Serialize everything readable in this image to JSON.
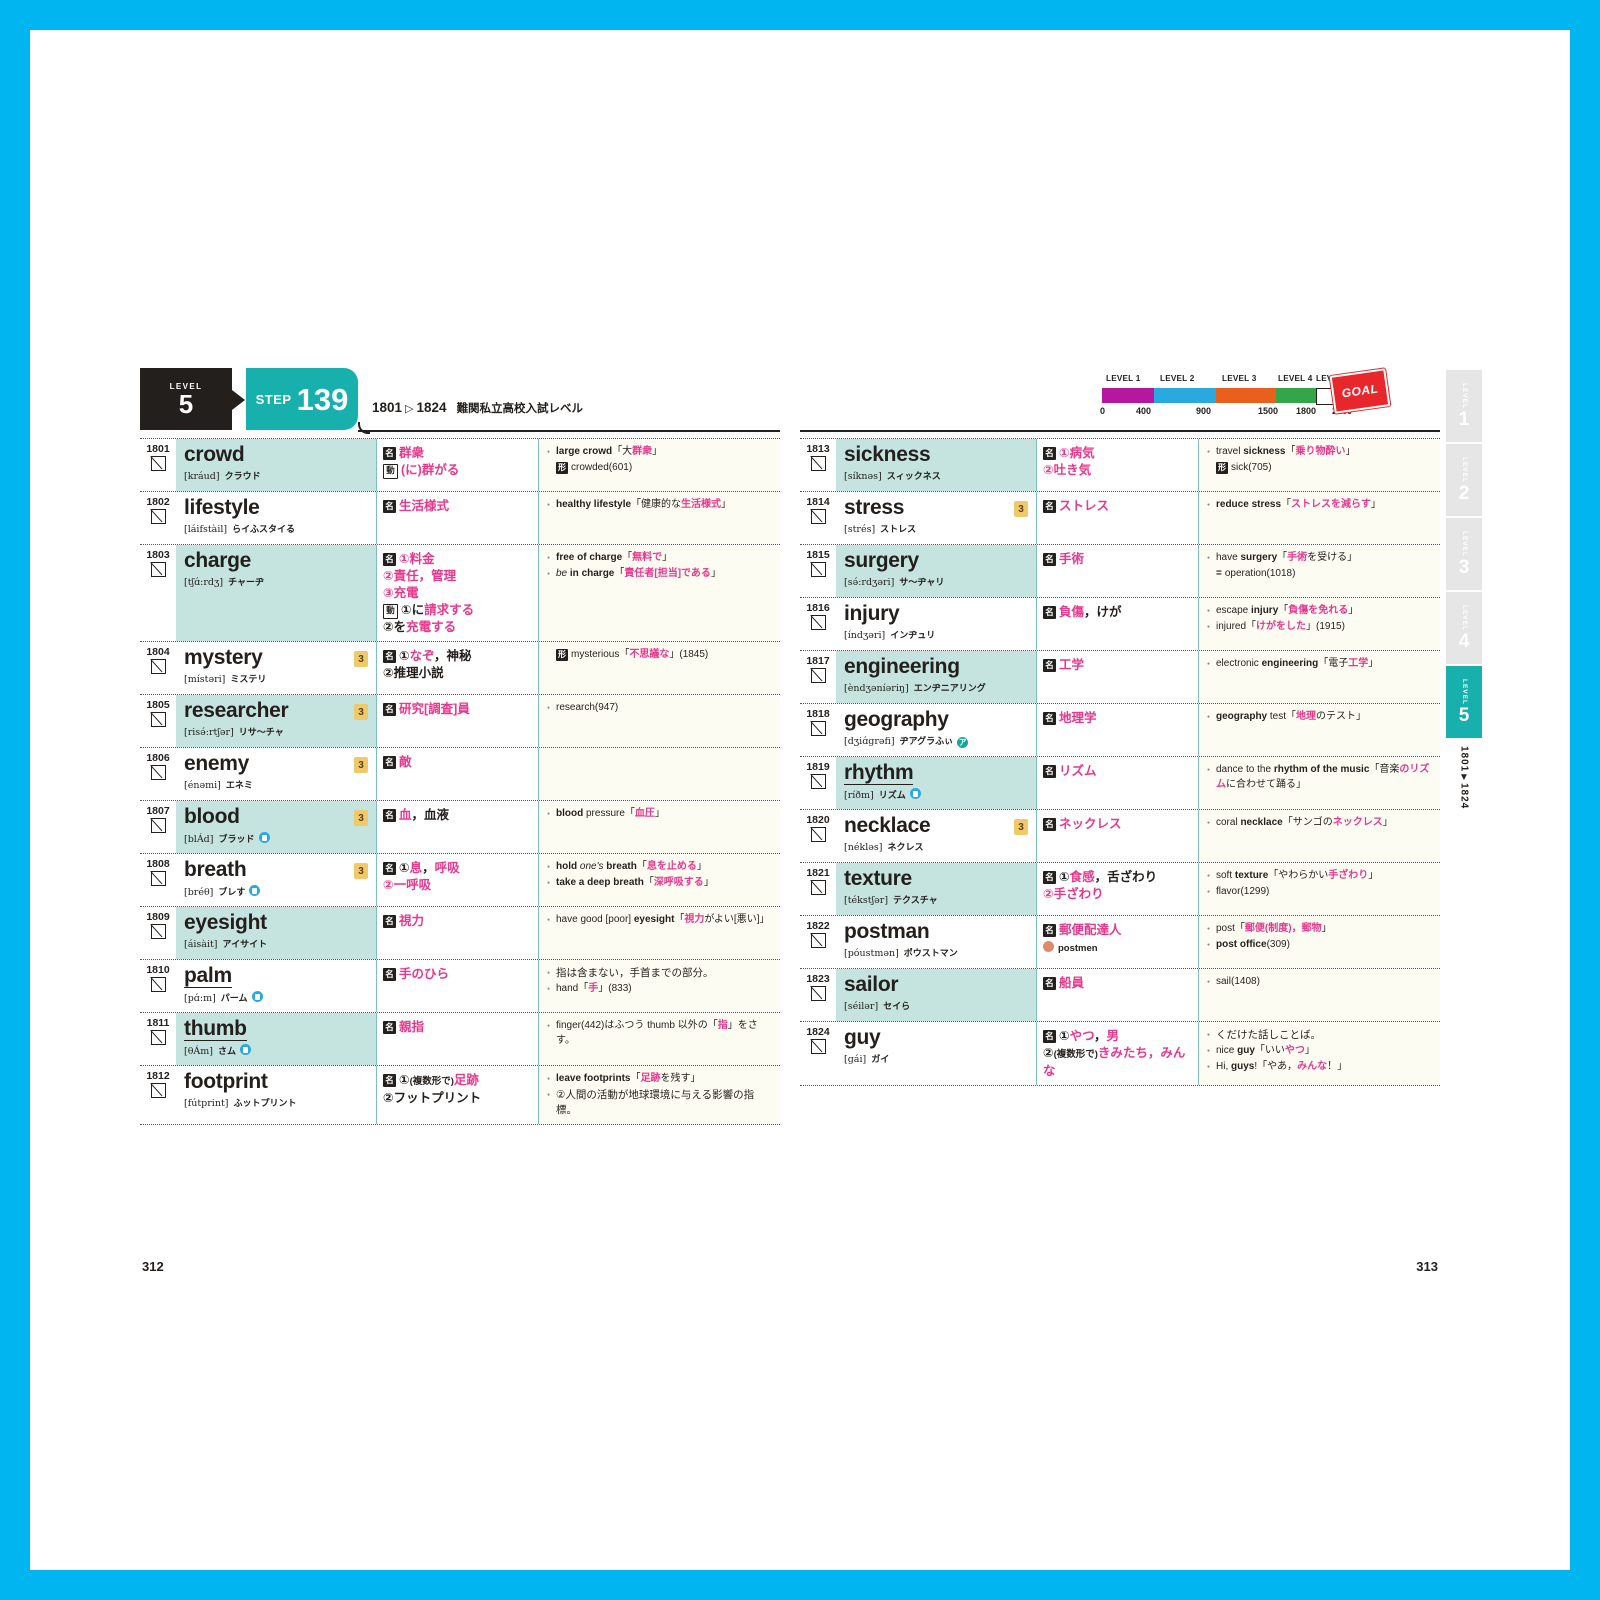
{
  "colors": {
    "frame": "#00b5f0",
    "accent_teal": "#18b0ad",
    "row_tint": "#c5e4e0",
    "example_bg": "#fdfcf2",
    "pink": "#e8388c",
    "badge3": "#f0c96a",
    "dark": "#231f1c"
  },
  "left_page": {
    "level_word": "LEVEL",
    "level_number": "5",
    "step_word": "STEP",
    "step_number": "139",
    "range_from": "1801",
    "range_arrow": "▷",
    "range_to": "1824",
    "range_note": "難関私立高校入試レベル",
    "page_number": "312"
  },
  "right_page": {
    "page_number": "313",
    "progress": {
      "labels": [
        "LEVEL 1",
        "LEVEL 2",
        "LEVEL 3",
        "LEVEL 4",
        "LEVEL 5"
      ],
      "ticks": [
        "0",
        "400",
        "900",
        "1500",
        "1800",
        "2100"
      ],
      "segment_colors": [
        "#b6179e",
        "#2aa9e0",
        "#e8601c",
        "#33a64a",
        "#ffffff"
      ],
      "goal_label": "GOAL"
    },
    "side_tabs": [
      {
        "label": "LEVEL",
        "number": "1",
        "active": false
      },
      {
        "label": "LEVEL",
        "number": "2",
        "active": false
      },
      {
        "label": "LEVEL",
        "number": "3",
        "active": false
      },
      {
        "label": "LEVEL",
        "number": "4",
        "active": false
      },
      {
        "label": "LEVEL",
        "number": "5",
        "active": true
      }
    ],
    "side_range_top": "1801",
    "side_range_mark": "▼",
    "side_range_bottom": "1824"
  },
  "entries_left": [
    {
      "num": "1801",
      "word": "crowd",
      "ipa": "[kráud]",
      "kana": "クラウド",
      "badge3": false,
      "speaker": false,
      "tint": true,
      "meanings": [
        {
          "pos": "名",
          "pos_type": "noun",
          "text": "群衆",
          "style": "pink"
        },
        {
          "pos": "動",
          "pos_type": "verb",
          "text": "(に)群がる",
          "style": "pink"
        }
      ],
      "examples": [
        {
          "bullet": true,
          "html": "<b>large crowd</b>「大<span class='pk'>群衆</span>」"
        },
        {
          "bullet": false,
          "tag": "形",
          "html": "crowded(601)"
        }
      ]
    },
    {
      "num": "1802",
      "word": "lifestyle",
      "ipa": "[láifstàil]",
      "kana": "らイふスタイる",
      "badge3": false,
      "speaker": false,
      "tint": false,
      "meanings": [
        {
          "pos": "名",
          "pos_type": "noun",
          "text": "生活様式",
          "style": "pink"
        }
      ],
      "examples": [
        {
          "bullet": true,
          "html": "<b>healthy lifestyle</b>「健康的な<span class='pk'>生活様式</span>」"
        }
      ]
    },
    {
      "num": "1803",
      "word": "charge",
      "ipa": "[tʃɑ́:rdʒ]",
      "kana": "チャーヂ",
      "badge3": false,
      "speaker": false,
      "tint": true,
      "meanings": [
        {
          "pos": "名",
          "pos_type": "noun",
          "text": "①料金",
          "style": "pink"
        },
        {
          "pos": "",
          "pos_type": "none",
          "text": "②責任，管理",
          "style": "pink"
        },
        {
          "pos": "",
          "pos_type": "none",
          "text": "③充電",
          "style": "pink"
        },
        {
          "pos": "動",
          "pos_type": "verb",
          "text": "①に<span class='pk'>請求する</span>",
          "style": "mixed"
        },
        {
          "pos": "",
          "pos_type": "none",
          "text": "②を<span class='pk'>充電する</span>",
          "style": "mixed"
        }
      ],
      "examples": [
        {
          "bullet": true,
          "html": "<b>free of charge</b>「<span class='pk'>無料で</span>」"
        },
        {
          "bullet": true,
          "html": "<i>be</i> <b>in charge</b>「<span class='pk'>責任者[担当]である</span>」"
        }
      ]
    },
    {
      "num": "1804",
      "word": "mystery",
      "ipa": "[místəri]",
      "kana": "ミステリ",
      "badge3": true,
      "speaker": false,
      "tint": false,
      "meanings": [
        {
          "pos": "名",
          "pos_type": "noun",
          "text": "①<span class='pk'>なぞ</span>，<span class='plain'>神秘</span>",
          "style": "mixed"
        },
        {
          "pos": "",
          "pos_type": "none",
          "text": "②推理小説",
          "style": "plain"
        }
      ],
      "examples": [
        {
          "bullet": false,
          "tag": "形",
          "html": "mysterious「<span class='pk'>不思議な</span>」(1845)"
        }
      ]
    },
    {
      "num": "1805",
      "word": "researcher",
      "ipa": "[risə́:rtʃər]",
      "kana": "リサ〜チャ",
      "badge3": true,
      "speaker": false,
      "tint": true,
      "meanings": [
        {
          "pos": "名",
          "pos_type": "noun",
          "text": "研究[調査]員",
          "style": "pink"
        }
      ],
      "examples": [
        {
          "bullet": true,
          "html": "research(947)"
        }
      ]
    },
    {
      "num": "1806",
      "word": "enemy",
      "ipa": "[énəmi]",
      "kana": "エネミ",
      "badge3": true,
      "speaker": false,
      "tint": false,
      "meanings": [
        {
          "pos": "名",
          "pos_type": "noun",
          "text": "敵",
          "style": "pink"
        }
      ],
      "examples": []
    },
    {
      "num": "1807",
      "word": "blood",
      "ipa": "[blÁd]",
      "kana": "ブラッド",
      "badge3": true,
      "speaker": true,
      "tint": true,
      "meanings": [
        {
          "pos": "名",
          "pos_type": "noun",
          "text": "<span class='pk'>血</span>，<span class='plain'>血液</span>",
          "style": "mixed"
        }
      ],
      "examples": [
        {
          "bullet": true,
          "html": "<b>blood</b> pressure「<span class='pk'>血圧</span>」"
        }
      ]
    },
    {
      "num": "1808",
      "word": "breath",
      "ipa": "[bréθ]",
      "kana": "ブレす",
      "badge3": true,
      "speaker": true,
      "tint": false,
      "meanings": [
        {
          "pos": "名",
          "pos_type": "noun",
          "text": "①<span class='pk'>息</span>，<span class='pk'>呼吸</span>",
          "style": "mixed"
        },
        {
          "pos": "",
          "pos_type": "none",
          "text": "②一呼吸",
          "style": "pink"
        }
      ],
      "examples": [
        {
          "bullet": true,
          "html": "<b>hold</b> <i>one's</i> <b>breath</b>「<span class='pk'>息を止める</span>」"
        },
        {
          "bullet": true,
          "html": "<b>take a deep breath</b>「<span class='pk'>深呼吸する</span>」"
        }
      ]
    },
    {
      "num": "1809",
      "word": "eyesight",
      "ipa": "[áisàit]",
      "kana": "アイサイト",
      "badge3": false,
      "speaker": false,
      "tint": true,
      "meanings": [
        {
          "pos": "名",
          "pos_type": "noun",
          "text": "視力",
          "style": "pink"
        }
      ],
      "examples": [
        {
          "bullet": true,
          "html": "have good [poor] <b>eyesight</b>「<span class='pk'>視力</span>がよい[悪い]」"
        }
      ]
    },
    {
      "num": "1810",
      "word": "palm",
      "ipa": "[pɑ́:m]",
      "kana": "パーム",
      "badge3": false,
      "speaker": true,
      "tint": false,
      "underline": true,
      "meanings": [
        {
          "pos": "名",
          "pos_type": "noun",
          "text": "手のひら",
          "style": "pink"
        }
      ],
      "examples": [
        {
          "bullet": true,
          "jp": true,
          "html": "指は含まない，手首までの部分。"
        },
        {
          "bullet": true,
          "html": "hand「<span class='pk'>手</span>」(833)"
        }
      ]
    },
    {
      "num": "1811",
      "word": "thumb",
      "ipa": "[θÁm]",
      "kana": "さム",
      "badge3": false,
      "speaker": true,
      "tint": true,
      "underline": true,
      "meanings": [
        {
          "pos": "名",
          "pos_type": "noun",
          "text": "親指",
          "style": "pink"
        }
      ],
      "examples": [
        {
          "bullet": true,
          "html": "finger(442)はふつう thumb 以外の「<span class='pk'>指</span>」をさす。"
        }
      ]
    },
    {
      "num": "1812",
      "word": "footprint",
      "ipa": "[fútprint]",
      "kana": "ふットプリント",
      "badge3": false,
      "speaker": false,
      "tint": false,
      "meanings": [
        {
          "pos": "名",
          "pos_type": "noun",
          "text": "①<span class='sub plain'>(複数形で)</span><span class='pk'>足跡</span>",
          "style": "mixed"
        },
        {
          "pos": "",
          "pos_type": "none",
          "text": "②フットプリント",
          "style": "plain"
        }
      ],
      "examples": [
        {
          "bullet": true,
          "html": "<b>leave footprints</b>「<span class='pk'>足跡</span>を残す」"
        },
        {
          "bullet": true,
          "jp": true,
          "html": "②人間の活動が地球環境に与える影響の指標。"
        }
      ]
    }
  ],
  "entries_right": [
    {
      "num": "1813",
      "word": "sickness",
      "ipa": "[síknəs]",
      "kana": "スィックネス",
      "badge3": false,
      "speaker": false,
      "tint": true,
      "meanings": [
        {
          "pos": "名",
          "pos_type": "noun",
          "text": "①病気",
          "style": "pink"
        },
        {
          "pos": "",
          "pos_type": "none",
          "text": "②吐き気",
          "style": "pink"
        }
      ],
      "examples": [
        {
          "bullet": true,
          "html": "travel <b>sickness</b>「<span class='pk'>乗り物酔い</span>」"
        },
        {
          "bullet": false,
          "tag": "形",
          "html": "sick(705)"
        }
      ]
    },
    {
      "num": "1814",
      "word": "stress",
      "ipa": "[strés]",
      "kana": "ストレス",
      "badge3": true,
      "speaker": false,
      "tint": false,
      "meanings": [
        {
          "pos": "名",
          "pos_type": "noun",
          "text": "ストレス",
          "style": "pink"
        }
      ],
      "examples": [
        {
          "bullet": true,
          "html": "<b>reduce stress</b>「<span class='pk'>ストレスを減らす</span>」"
        }
      ]
    },
    {
      "num": "1815",
      "word": "surgery",
      "ipa": "[sə́:rdʒəri]",
      "kana": "サ〜ヂャリ",
      "badge3": false,
      "speaker": false,
      "tint": true,
      "meanings": [
        {
          "pos": "名",
          "pos_type": "noun",
          "text": "手術",
          "style": "pink"
        }
      ],
      "examples": [
        {
          "bullet": true,
          "html": "have <b>surgery</b>「<span class='pk'>手術</span>を受ける」"
        },
        {
          "bullet": false,
          "eq": true,
          "html": "operation(1018)"
        }
      ]
    },
    {
      "num": "1816",
      "word": "injury",
      "ipa": "[índʒəri]",
      "kana": "インヂュリ",
      "badge3": false,
      "speaker": false,
      "tint": false,
      "meanings": [
        {
          "pos": "名",
          "pos_type": "noun",
          "text": "<span class='pk'>負傷</span>，<span class='plain'>けが</span>",
          "style": "mixed"
        }
      ],
      "examples": [
        {
          "bullet": true,
          "html": "escape <b>injury</b>「<span class='pk'>負傷を免れる</span>」"
        },
        {
          "bullet": true,
          "html": "injured「<span class='pk'>けがをした</span>」(1915)"
        }
      ]
    },
    {
      "num": "1817",
      "word": "engineering",
      "ipa": "[èndʒəníəriŋ]",
      "kana": "エンヂニアリング",
      "badge3": false,
      "speaker": false,
      "tint": true,
      "meanings": [
        {
          "pos": "名",
          "pos_type": "noun",
          "text": "工学",
          "style": "pink"
        }
      ],
      "examples": [
        {
          "bullet": true,
          "html": "electronic <b>engineering</b>「電子<span class='pk'>工学</span>」"
        }
      ]
    },
    {
      "num": "1818",
      "word": "geography",
      "ipa": "[dʒiɑ́grəfi]",
      "kana": "ヂアグラふぃ",
      "badge3": false,
      "speaker": false,
      "accent": true,
      "tint": false,
      "meanings": [
        {
          "pos": "名",
          "pos_type": "noun",
          "text": "地理学",
          "style": "pink"
        }
      ],
      "examples": [
        {
          "bullet": true,
          "html": "<b>geography</b> test「<span class='pk'>地理</span>のテスト」"
        }
      ]
    },
    {
      "num": "1819",
      "word": "rhythm",
      "ipa": "[ríðm]",
      "kana": "リズム",
      "badge3": false,
      "speaker": true,
      "tint": true,
      "underline": true,
      "meanings": [
        {
          "pos": "名",
          "pos_type": "noun",
          "text": "リズム",
          "style": "pink"
        }
      ],
      "examples": [
        {
          "bullet": true,
          "html": "dance to the <b>rhythm of the music</b>「音楽<span class='pk'>のリズム</span>に合わせて踊る」"
        }
      ]
    },
    {
      "num": "1820",
      "word": "necklace",
      "ipa": "[nékləs]",
      "kana": "ネクレス",
      "badge3": true,
      "speaker": false,
      "tint": false,
      "meanings": [
        {
          "pos": "名",
          "pos_type": "noun",
          "text": "ネックレス",
          "style": "pink"
        }
      ],
      "examples": [
        {
          "bullet": true,
          "html": "coral <b>necklace</b>「サンゴの<span class='pk'>ネックレス</span>」"
        }
      ]
    },
    {
      "num": "1821",
      "word": "texture",
      "ipa": "[tékstʃər]",
      "kana": "テクスチャ",
      "badge3": false,
      "speaker": false,
      "tint": true,
      "meanings": [
        {
          "pos": "名",
          "pos_type": "noun",
          "text": "①<span class='pk'>食感</span>，<span class='plain'>舌ざわり</span>",
          "style": "mixed"
        },
        {
          "pos": "",
          "pos_type": "none",
          "text": "②手ざわり",
          "style": "pink"
        }
      ],
      "examples": [
        {
          "bullet": true,
          "html": "soft <b>texture</b>「やわらかい<span class='pk'>手ざわり</span>」"
        },
        {
          "bullet": true,
          "html": "flavor(1299)"
        }
      ]
    },
    {
      "num": "1822",
      "word": "postman",
      "ipa": "[póustmən]",
      "kana": "ポウストマン",
      "badge3": false,
      "speaker": false,
      "tint": false,
      "meanings": [
        {
          "pos": "名",
          "pos_type": "noun",
          "text": "郵便配達人",
          "style": "pink"
        },
        {
          "pos": "",
          "pos_type": "irr",
          "text": "postmen",
          "style": "plain-small"
        }
      ],
      "examples": [
        {
          "bullet": true,
          "html": "post「<span class='pk'>郵便(制度)，郵物</span>」"
        },
        {
          "bullet": true,
          "html": "<b>post office</b>(309)"
        }
      ]
    },
    {
      "num": "1823",
      "word": "sailor",
      "ipa": "[séilər]",
      "kana": "セイら",
      "badge3": false,
      "speaker": false,
      "tint": true,
      "meanings": [
        {
          "pos": "名",
          "pos_type": "noun",
          "text": "船員",
          "style": "pink"
        }
      ],
      "examples": [
        {
          "bullet": true,
          "html": "sail(1408)"
        }
      ]
    },
    {
      "num": "1824",
      "word": "guy",
      "ipa": "[gái]",
      "kana": "ガイ",
      "badge3": false,
      "speaker": false,
      "tint": false,
      "meanings": [
        {
          "pos": "名",
          "pos_type": "noun",
          "text": "①<span class='pk'>やつ</span>，<span class='pk'>男</span>",
          "style": "mixed"
        },
        {
          "pos": "",
          "pos_type": "none",
          "text": "②<span class='sub plain'>(複数形で)</span><span class='pk'>きみたち，みんな</span>",
          "style": "mixed"
        }
      ],
      "examples": [
        {
          "bullet": true,
          "jp": true,
          "html": "くだけた話しことば。"
        },
        {
          "bullet": true,
          "html": "nice <b>guy</b>「いい<span class='pk'>やつ</span>」"
        },
        {
          "bullet": true,
          "html": "Hi, <b>guys</b>!「やあ，<span class='pk'>みんな</span>！」"
        }
      ]
    }
  ]
}
